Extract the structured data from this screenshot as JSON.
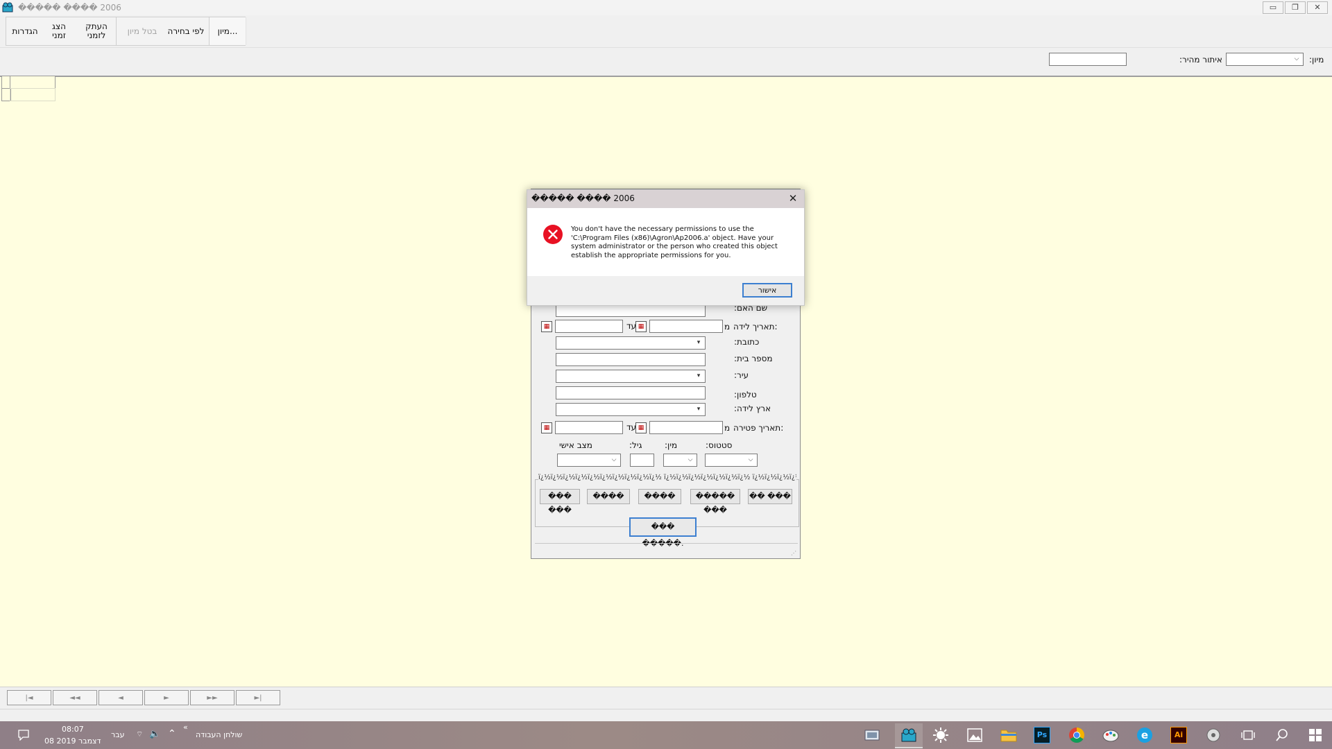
{
  "window": {
    "title": "����� ���� 2006",
    "minimize_icon": "minimize-icon",
    "restore_icon": "restore-icon",
    "close_icon": "close-icon"
  },
  "toolbar": {
    "settings": "הגדרות",
    "show_temp_line1": "הצג",
    "show_temp_line2": "זמני",
    "copy_temp_line1": "העתק",
    "copy_temp_line2": "לזמני",
    "by_selection": "לפי בחירה",
    "cancel_sort": "בטל מיון",
    "sort": "מיון..."
  },
  "filter": {
    "sort_label": ":מיון",
    "quick_search_label": ":איתור מהיר",
    "sort_value": "",
    "quick_search_value": ""
  },
  "nav": {
    "buttons": [
      "|◄",
      "◄◄",
      "◄",
      "►",
      "►►",
      "►|"
    ]
  },
  "form": {
    "mother_name_label": ":שם האם",
    "birth_date_label": "תאריך לידה:",
    "from_marker": "מ",
    "to_label": "עד",
    "address_label": ":כתובת",
    "house_number_label": ":מספר בית",
    "city_label": ":עיר",
    "phone_label": ":טלפון",
    "birth_country_label": ":ארץ לידה",
    "death_date_label": "תאריך פטירה:",
    "marital_status_label": "מצב אישי",
    "age_label": ":גיל",
    "gender_label": ":מין",
    "status_label": ":סטטוס",
    "group_caption": "ï¿½ï¿½ï¿½ï¿½ï¿½ï¿½ï¿½ï¿½ï¿½ï¿½ ï¿½ï¿½ï¿½ï¿½ï¿½ï¿½ï¿½ ï¿½ï¿½ï¿½ï¿½ï¿½ï¿½ï¿½ï¿½",
    "buttons": [
      "��� ���",
      "����",
      "����",
      "����� ���",
      "�� ���"
    ],
    "search_button": "��� �����."
  },
  "dialog": {
    "title": "����� ���� 2006",
    "message": "You don't have the necessary permissions to use the 'C:\\Program Files (x86)\\Agron\\Ap2006.a' object.  Have your system administrator or the person who created this object establish the appropriate permissions for you.",
    "ok": "אישור",
    "error_color": "#e81123"
  },
  "taskbar": {
    "time": "08:07",
    "date": "08 דצמבר 2019",
    "language": "עבר",
    "desktop": "שולחן העבודה",
    "desktop_chevron": "«",
    "icons": [
      "notification-icon",
      "network-icon",
      "volume-icon",
      "show-hidden-icons-icon",
      "windows-start-icon",
      "search-icon",
      "task-view-icon",
      "settings-app-icon",
      "illustrator-icon",
      "ie-edge-icon",
      "paint-icon",
      "chrome-icon",
      "photoshop-icon",
      "file-explorer-icon",
      "photos-icon",
      "brightness-icon",
      "agron-app-icon",
      "screen-capture-icon"
    ],
    "illustrator_label": "Ai",
    "photoshop_label": "Ps",
    "edge_label": "e"
  }
}
